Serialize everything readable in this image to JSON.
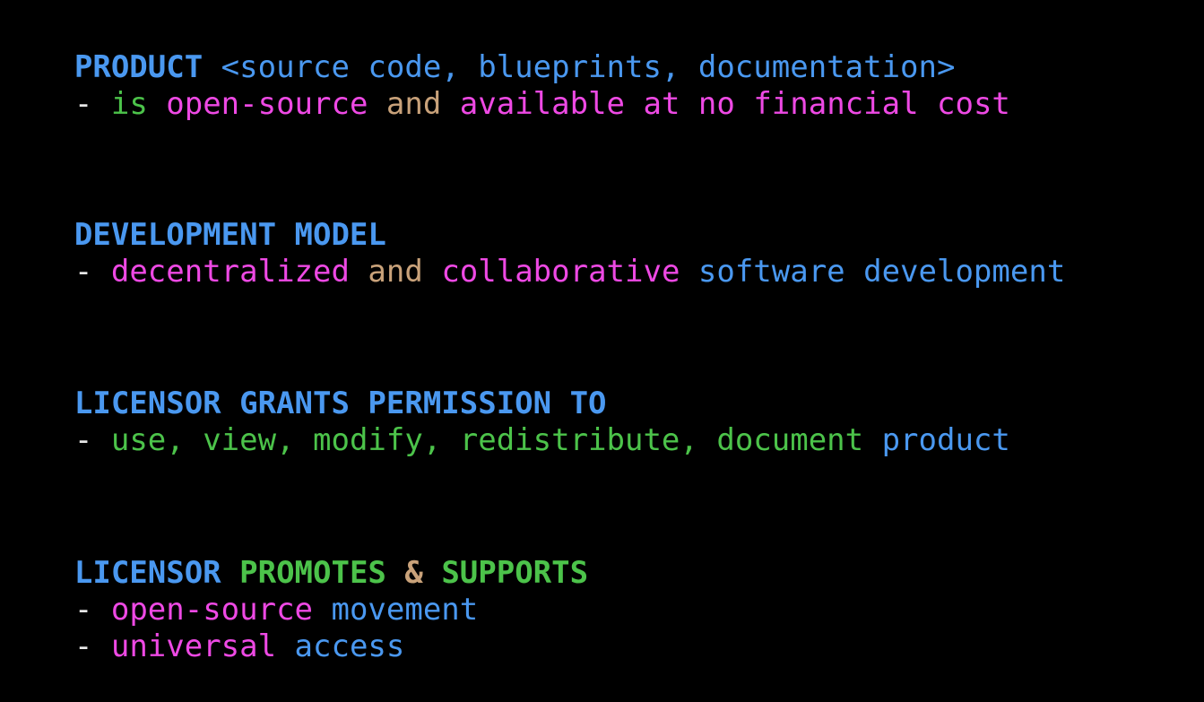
{
  "colors": {
    "background": "#000000",
    "heading": "#4a98f0",
    "green": "#4cc34a",
    "magenta": "#ee49e4",
    "tan": "#c9a27a",
    "muted": "#a7a7a7"
  },
  "sections": [
    {
      "heading": [
        {
          "text": "PRODUCT",
          "style": "blue-b"
        },
        {
          "text": " <source code, blueprints, documentation>",
          "style": "blue"
        }
      ],
      "lines": [
        [
          {
            "text": "- ",
            "style": "white"
          },
          {
            "text": "is ",
            "style": "green"
          },
          {
            "text": "open-source ",
            "style": "magenta"
          },
          {
            "text": "and ",
            "style": "tan"
          },
          {
            "text": "available at no financial cost",
            "style": "magenta"
          }
        ]
      ]
    },
    {
      "heading": [
        {
          "text": "DEVELOPMENT MODEL",
          "style": "blue-b"
        }
      ],
      "lines": [
        [
          {
            "text": "- ",
            "style": "white"
          },
          {
            "text": "decentralized ",
            "style": "magenta"
          },
          {
            "text": "and ",
            "style": "tan"
          },
          {
            "text": "collaborative ",
            "style": "magenta"
          },
          {
            "text": "software development",
            "style": "blue"
          }
        ]
      ]
    },
    {
      "heading": [
        {
          "text": "LICENSOR GRANTS PERMISSION TO",
          "style": "blue-b"
        }
      ],
      "lines": [
        [
          {
            "text": "- ",
            "style": "white"
          },
          {
            "text": "use, view, modify, redistribute, document ",
            "style": "green"
          },
          {
            "text": "product",
            "style": "blue"
          }
        ]
      ]
    },
    {
      "heading": [
        {
          "text": "LICENSOR ",
          "style": "blue-b"
        },
        {
          "text": "PROMOTES ",
          "style": "green-b"
        },
        {
          "text": "& ",
          "style": "tan-b"
        },
        {
          "text": "SUPPORTS",
          "style": "green-b"
        }
      ],
      "lines": [
        [
          {
            "text": "- ",
            "style": "white"
          },
          {
            "text": "open-source ",
            "style": "magenta"
          },
          {
            "text": "movement",
            "style": "blue"
          }
        ],
        [
          {
            "text": "- ",
            "style": "white"
          },
          {
            "text": "universal ",
            "style": "magenta"
          },
          {
            "text": "access",
            "style": "blue"
          }
        ]
      ]
    }
  ]
}
